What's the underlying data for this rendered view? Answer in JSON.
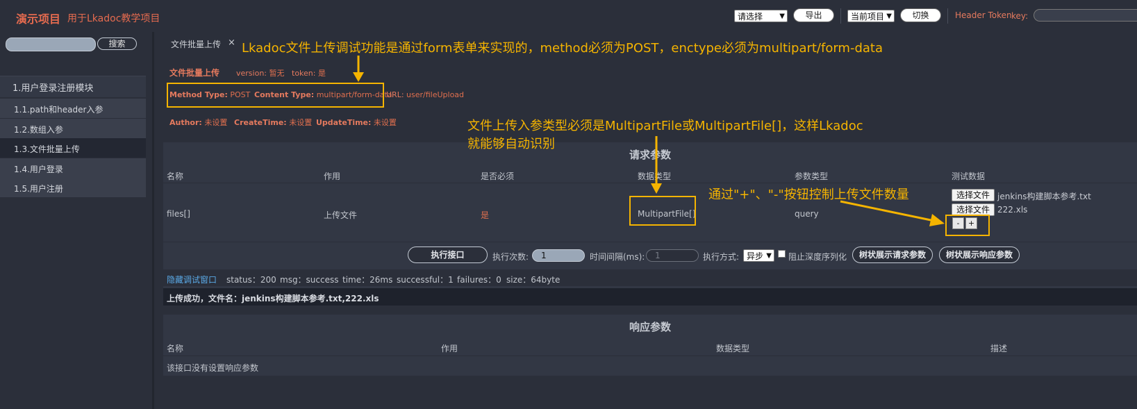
{
  "header": {
    "brand": "演示项目",
    "subtitle": "用于Lkadoc教学项目",
    "select_choose": "请选择",
    "export_btn": "导出",
    "project_select": "当前项目",
    "switch_btn": "切换",
    "token_label": "Header Token",
    "key_label": "key:"
  },
  "sidebar": {
    "search_placeholder": "",
    "search_btn": "搜索",
    "module": "1.用户登录注册模块",
    "items": [
      {
        "label": "1.1.path和header入参"
      },
      {
        "label": "1.2.数组入参"
      },
      {
        "label": "1.3.文件批量上传",
        "active": true
      },
      {
        "label": "1.4.用户登录"
      },
      {
        "label": "1.5.用户注册"
      }
    ]
  },
  "tab": {
    "label": "文件批量上传",
    "close": "×"
  },
  "api": {
    "title": "文件批量上传",
    "version_label": "version:",
    "version": "暂无",
    "token_label": "token:",
    "token": "是",
    "method_label": "Method Type:",
    "method": "POST",
    "content_label": "Content Type:",
    "content": "multipart/form-data",
    "url_label": "URL:",
    "url": "user/fileUpload",
    "author_label": "Author:",
    "author": "未设置",
    "create_label": "CreateTime:",
    "create": "未设置",
    "update_label": "UpdateTime:",
    "update": "未设置"
  },
  "params": {
    "title": "请求参数",
    "headers": [
      "名称",
      "作用",
      "是否必须",
      "数据类型",
      "参数类型",
      "测试数据"
    ],
    "row": {
      "name": "files[]",
      "purpose": "上传文件",
      "required": "是",
      "datatype": "MultipartFile[]",
      "paramtype": "query"
    },
    "files": [
      {
        "btn": "选择文件",
        "name": "jenkins构建脚本参考.txt"
      },
      {
        "btn": "选择文件",
        "name": "222.xls"
      }
    ],
    "minus": "-",
    "plus": "+"
  },
  "controls": {
    "exec_btn": "执行接口",
    "count_label": "执行次数:",
    "count_value": "1",
    "interval_label": "时间间隔(ms):",
    "interval_value": "1",
    "mode_label": "执行方式:",
    "mode_value": "异步",
    "block_label": "阻止深度序列化",
    "tree_req_btn": "树状展示请求参数",
    "tree_resp_btn": "树状展示响应参数"
  },
  "status": {
    "hide_link": "隐藏调试窗口",
    "status": "status：200",
    "msg": "msg：success",
    "time": "time：26ms",
    "successful": "successful：1",
    "failures": "failures：0",
    "size": "size：64byte",
    "result": "上传成功，文件名：jenkins构建脚本参考.txt,222.xls"
  },
  "response": {
    "title": "响应参数",
    "headers": [
      "名称",
      "作用",
      "数据类型",
      "描述"
    ],
    "empty": "该接口没有设置响应参数"
  },
  "annotations": {
    "top": "Lkadoc文件上传调试功能是通过form表单来实现的，method必须为POST，enctype必须为multipart/form-data",
    "mid_line1": "文件上传入参类型必须是MultipartFile或MultipartFile[]，这样Lkadoc",
    "mid_line2": "就能够自动识别",
    "right": "通过\"+\"、\"-\"按钮控制上传文件数量",
    "color": "#f5b400"
  }
}
